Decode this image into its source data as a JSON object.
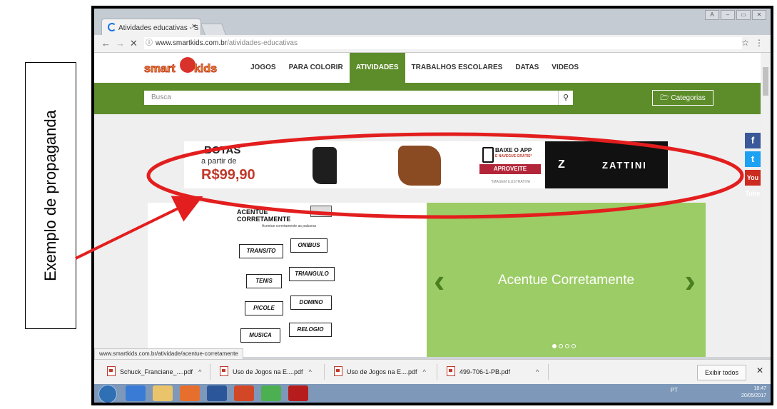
{
  "annotation": {
    "label": "Exemplo de propaganda"
  },
  "browser": {
    "tab_title": "Atividades educativas - S",
    "tab_close": "×",
    "back_icon": "←",
    "forward_icon": "→",
    "stop_icon": "✕",
    "info_icon": "ⓘ",
    "url_host": "www.smartkids.com.br",
    "url_path": "/atividades-educativas",
    "star_icon": "☆",
    "menu_icon": "⋮",
    "window_buttons": [
      "A",
      "–",
      "▭",
      "✕"
    ]
  },
  "site": {
    "logo_smart": "smart",
    "logo_kids": "kids",
    "nav": [
      {
        "label": "JOGOS",
        "active": false
      },
      {
        "label": "PARA COLORIR",
        "active": false
      },
      {
        "label": "ATIVIDADES",
        "active": true
      },
      {
        "label": "TRABALHOS ESCOLARES",
        "active": false
      },
      {
        "label": "DATAS",
        "active": false
      },
      {
        "label": "VIDEOS",
        "active": false
      }
    ],
    "search_placeholder": "Busca",
    "search_icon": "⚲",
    "categories_label": "🗁 Categorias",
    "social": {
      "facebook": "f",
      "twitter": "t",
      "youtube": "You Tube"
    }
  },
  "ad": {
    "headline": "BOTAS",
    "prefix": "a partir de",
    "price": "R$99,90",
    "app_line1": "BAIXE O APP",
    "app_line2": "E NAVEGUE GRÁTIS*",
    "cta": "APROVEITE",
    "disclaimer": "*IMAGEM ILUSTRATIVA",
    "brand_mark": "Z",
    "brand": "ZATTINI"
  },
  "slider": {
    "worksheet_title_1": "ACENTUE",
    "worksheet_title_2": "CORRETAMENTE",
    "worksheet_subtitle": "Acentue corretamente as palavras",
    "words": [
      "TRANSITO",
      "ONIBUS",
      "TENIS",
      "TRIANGULO",
      "PICOLE",
      "DOMINO",
      "MUSICA",
      "RELOGIO"
    ],
    "slide_title": "Acentue Corretamente",
    "prev_icon": "‹",
    "next_icon": "›",
    "dots_total": 4,
    "dots_active": 1
  },
  "status_url": "www.smartkids.com.br/atividade/acentue-corretamente",
  "downloads": {
    "items": [
      "Schuck_Franciane_....pdf",
      "Uso de Jogos na E....pdf",
      "Uso de Jogos na E....pdf",
      "499-706-1-PB.pdf"
    ],
    "chevron": "^",
    "show_all": "Exibir todos",
    "close": "✕"
  },
  "taskbar": {
    "tray": "PT",
    "time": "18:47",
    "date": "20/05/2017"
  },
  "colors": {
    "site_green": "#5d8c2a",
    "slide_green": "#9ccc65",
    "annotation_red": "#e31e1e"
  }
}
